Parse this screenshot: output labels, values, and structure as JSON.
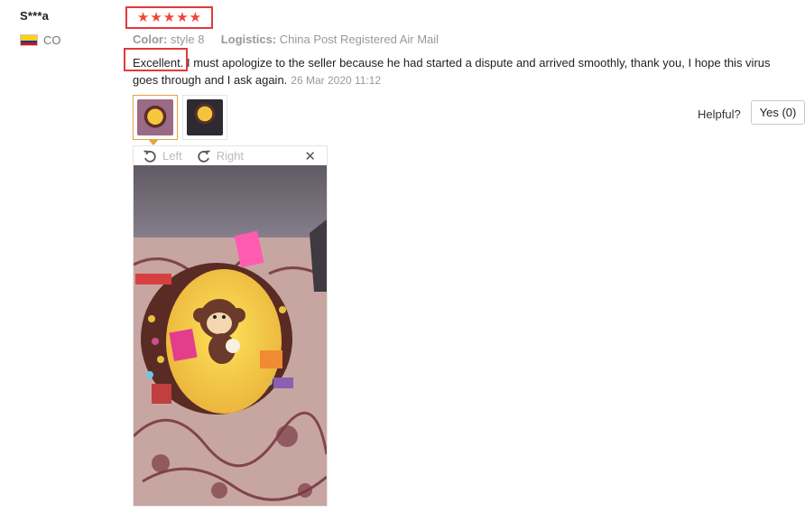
{
  "reviewer": {
    "name": "S***a",
    "country": "CO",
    "flag_icon": "colombia-flag-icon"
  },
  "rating": {
    "stars": 5,
    "of": 5,
    "star_glyph": "★",
    "color": "#f44336"
  },
  "meta": {
    "color_key": "Color:",
    "color_value": "style 8",
    "logistics_key": "Logistics:",
    "logistics_value": "China Post Registered Air Mail"
  },
  "review": {
    "highlight": "Excellent.",
    "text": " I must apologize to the seller because he had started a dispute and arrived smoothly, thank you, I hope this virus goes through and I ask again.",
    "date": "26 Mar 2020 11:12"
  },
  "helpful": {
    "label": "Helpful?",
    "button": "Yes (0)"
  },
  "viewer": {
    "left_label": "Left",
    "right_label": "Right",
    "close_glyph": "✕"
  },
  "colors": {
    "highlight_border": "#e3393c",
    "selected_thumb": "#e8a040"
  }
}
